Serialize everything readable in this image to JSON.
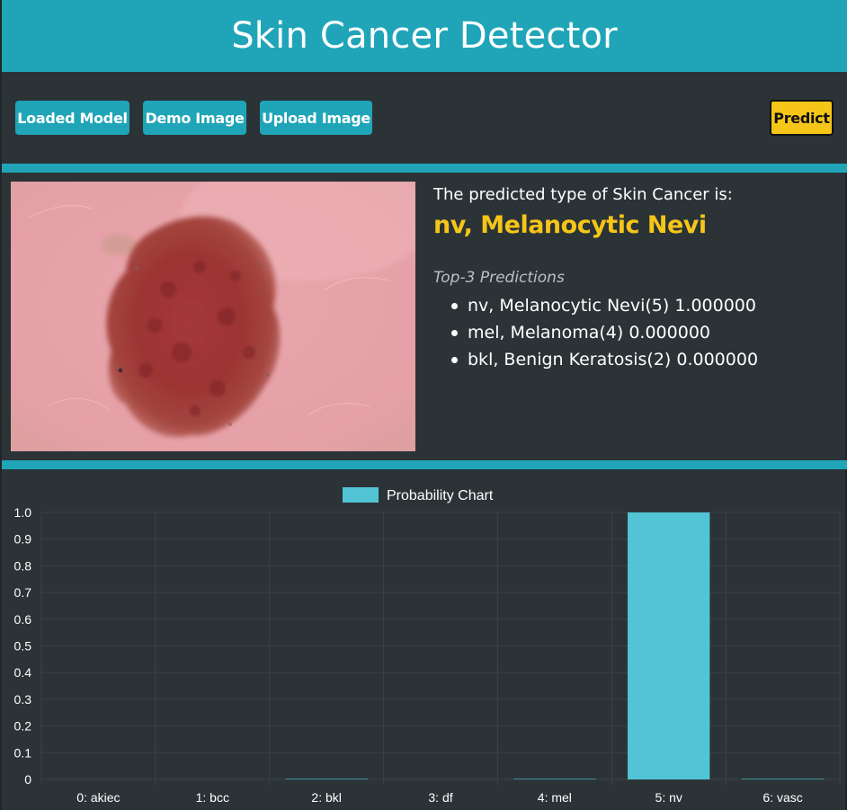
{
  "app": {
    "title": "Skin Cancer Detector"
  },
  "toolbar": {
    "loaded_model_label": "Loaded Model",
    "demo_image_label": "Demo Image",
    "upload_image_label": "Upload Image",
    "predict_label": "Predict"
  },
  "result": {
    "caption": "The predicted type of Skin Cancer is:",
    "prediction": "nv, Melanocytic Nevi",
    "top3_title": "Top-3 Predictions",
    "top3": [
      "nv, Melanocytic Nevi(5) 1.000000",
      "mel, Melanoma(4) 0.000000",
      "bkl, Benign Keratosis(2) 0.000000"
    ]
  },
  "colors": {
    "accent": "#20a5b8",
    "background": "#2b3337",
    "highlight": "#f5c518",
    "bar": "#52c4d6"
  },
  "chart_data": {
    "type": "bar",
    "legend": [
      "Probability Chart"
    ],
    "legend_position": "top",
    "categories": [
      "0: akiec",
      "1: bcc",
      "2: bkl",
      "3: df",
      "4: mel",
      "5: nv",
      "6: vasc"
    ],
    "series": [
      {
        "name": "Probability Chart",
        "values": [
          0.0,
          0.0,
          0.002,
          0.0,
          0.002,
          1.0,
          0.002
        ]
      }
    ],
    "ylim": [
      0,
      1.0
    ],
    "yticks": [
      "1.0",
      "0.9",
      "0.8",
      "0.7",
      "0.6",
      "0.5",
      "0.4",
      "0.3",
      "0.2",
      "0.1",
      "0"
    ],
    "grid": true
  }
}
